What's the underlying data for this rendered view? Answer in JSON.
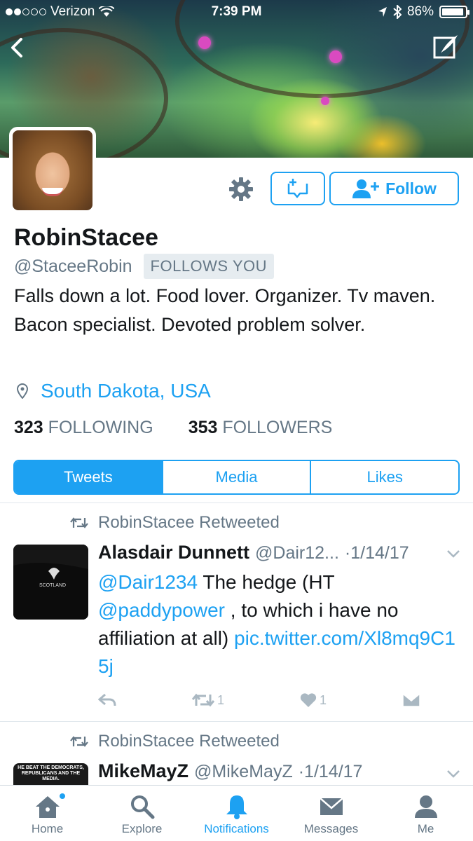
{
  "status_bar": {
    "carrier": "Verizon",
    "time": "7:39 PM",
    "battery": "86%"
  },
  "profile": {
    "display_name": "RobinStacee",
    "handle": "@StaceeRobin",
    "follows_you": "FOLLOWS YOU",
    "bio": "Falls down a lot. Food lover. Organizer. Tv maven. Bacon specialist. Devoted problem solver.",
    "location": "South Dakota, USA",
    "following_count": "323",
    "following_label": "FOLLOWING",
    "followers_count": "353",
    "followers_label": "FOLLOWERS",
    "follow_label": "Follow"
  },
  "tabs": [
    "Tweets",
    "Media",
    "Likes"
  ],
  "tweets": [
    {
      "retweeted_by": "RobinStacee Retweeted",
      "name": "Alasdair Dunnett",
      "handle": "@Dair12...",
      "date": "·1/14/17",
      "text_link1": "@Dair1234",
      "text_plain1": " The hedge (HT ",
      "text_link2": "@paddypower",
      "text_plain2": " , to which i have no affiliation at all) ",
      "text_link3": "pic.twitter.com/Xl8mq9C15j",
      "retweets": "1",
      "likes": "1",
      "avatar_text": "SCOTLAND"
    },
    {
      "retweeted_by": "RobinStacee Retweeted",
      "name": "MikeMayZ",
      "handle": "@MikeMayZ",
      "date": "·1/14/17",
      "avatar_text": "HE BEAT THE DEMOCRATS, REPUBLICANS AND THE MEDIA."
    }
  ],
  "tabbar": [
    "Home",
    "Explore",
    "Notifications",
    "Messages",
    "Me"
  ],
  "colors": {
    "accent": "#1da1f2",
    "text": "#14171a",
    "muted": "#657786"
  }
}
